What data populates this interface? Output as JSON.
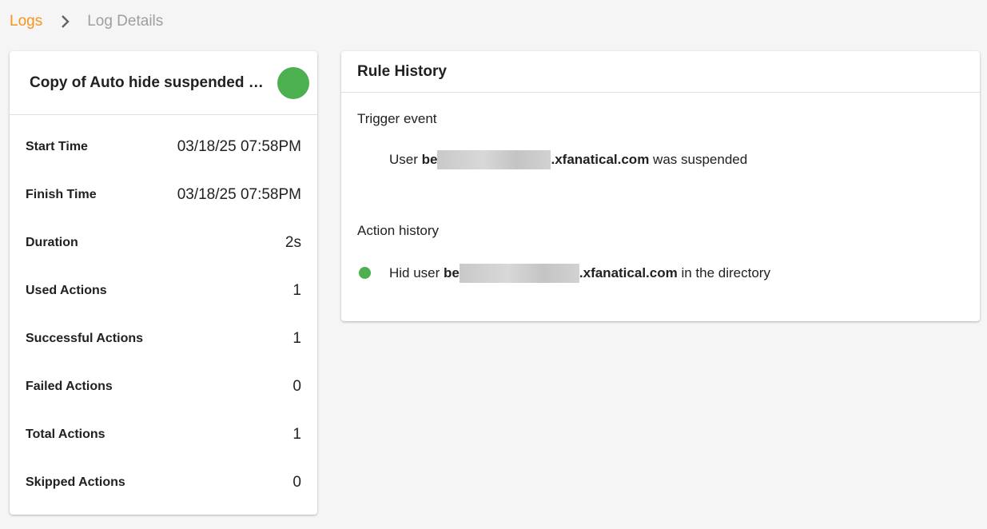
{
  "breadcrumb": {
    "logs": "Logs",
    "current": "Log Details"
  },
  "summary": {
    "title": "Copy of Auto hide suspended users",
    "status_color": "#4caf50",
    "stats": [
      {
        "label": "Start Time",
        "value": "03/18/25 07:58PM"
      },
      {
        "label": "Finish Time",
        "value": "03/18/25 07:58PM"
      },
      {
        "label": "Duration",
        "value": "2s"
      },
      {
        "label": "Used Actions",
        "value": "1"
      },
      {
        "label": "Successful Actions",
        "value": "1"
      },
      {
        "label": "Failed Actions",
        "value": "0"
      },
      {
        "label": "Total Actions",
        "value": "1"
      },
      {
        "label": "Skipped Actions",
        "value": "0"
      }
    ]
  },
  "history": {
    "title": "Rule History",
    "trigger_title": "Trigger event",
    "trigger": {
      "prefix": "User",
      "user_start": "be",
      "user_end": ".xfanatical.com",
      "suffix": "was suspended"
    },
    "action_title": "Action history",
    "actions": [
      {
        "prefix": "Hid user",
        "user_start": "be",
        "user_end": ".xfanatical.com",
        "suffix": "in the directory",
        "status_color": "#4caf50"
      }
    ]
  },
  "colors": {
    "accent": "#f7941d",
    "success": "#4caf50"
  }
}
